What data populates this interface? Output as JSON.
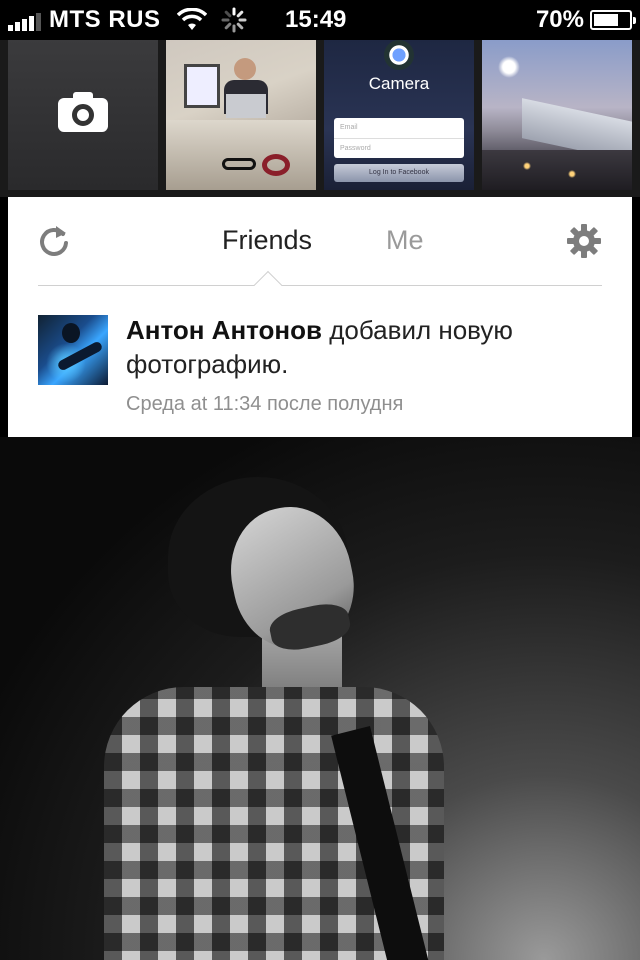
{
  "status_bar": {
    "carrier": "MTS RUS",
    "time": "15:49",
    "battery_percent_label": "70%",
    "battery_level": 0.7
  },
  "photo_strip": {
    "items": [
      {
        "kind": "camera",
        "icon": "camera-icon"
      },
      {
        "kind": "photo",
        "subject": "office-desk"
      },
      {
        "kind": "app-screenshot",
        "title": "Camera",
        "email_placeholder": "Email",
        "password_placeholder": "Password",
        "login_label": "Log In to Facebook"
      },
      {
        "kind": "photo",
        "subject": "airplane-wing"
      }
    ]
  },
  "tabs": {
    "friends": "Friends",
    "me": "Me",
    "active": "friends"
  },
  "icons": {
    "refresh": "refresh-icon",
    "settings": "gear-icon"
  },
  "feed": {
    "author": "Антон Антонов",
    "action": " добавил новую фотографию.",
    "timestamp": "Среда at 11:34 после полудня"
  },
  "colors": {
    "background": "#000000",
    "card": "#ffffff",
    "tab_active": "#222222",
    "tab_inactive": "#9a9a9a",
    "timestamp": "#8f8f8f"
  }
}
